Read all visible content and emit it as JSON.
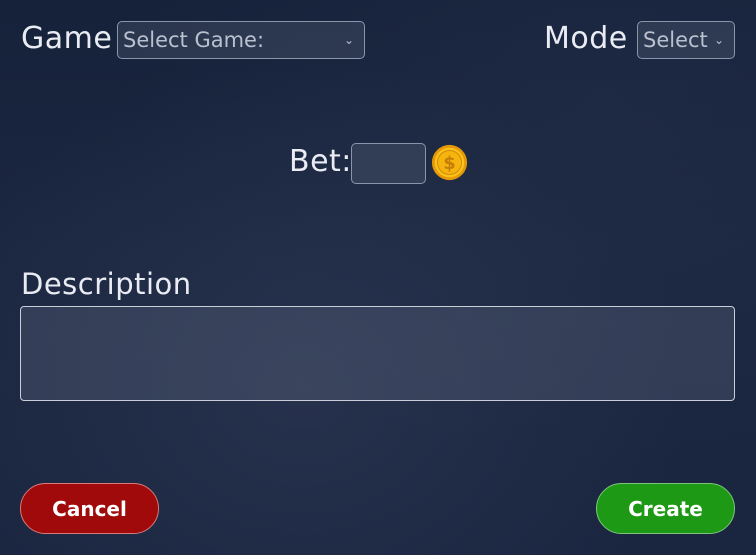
{
  "game": {
    "label": "Game",
    "select_value": "Select Game:"
  },
  "mode": {
    "label": "Mode",
    "select_value": "Select"
  },
  "bet": {
    "label": "Bet:",
    "value": ""
  },
  "coin_icon": "gold-coin-dollar-icon",
  "description": {
    "label": "Description",
    "value": ""
  },
  "buttons": {
    "cancel": "Cancel",
    "create": "Create"
  },
  "colors": {
    "cancel": "#a00a0a",
    "create": "#1e9915",
    "coin": "#f5b50e"
  }
}
